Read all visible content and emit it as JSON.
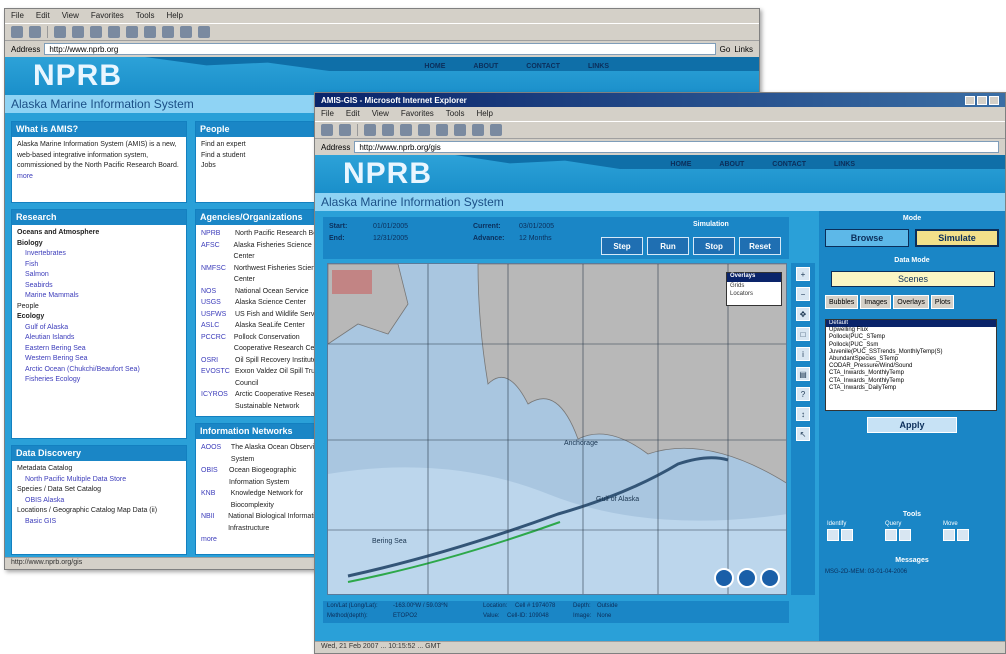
{
  "back_window": {
    "menu": [
      "File",
      "Edit",
      "View",
      "Favorites",
      "Tools",
      "Help"
    ],
    "address_label": "Address",
    "address": "http://www.nprb.org",
    "go_label": "Go",
    "links_label": "Links",
    "status": "http://www.nprb.org/gis"
  },
  "front_window": {
    "title": "AMIS-GIS - Microsoft Internet Explorer",
    "menu": [
      "File",
      "Edit",
      "View",
      "Favorites",
      "Tools",
      "Help"
    ],
    "address_label": "Address",
    "address": "http://www.nprb.org/gis",
    "status": "Wed, 21 Feb 2007 ... 10:15:52 ... GMT"
  },
  "site": {
    "logo": "NPRB",
    "subtitle": "Alaska Marine Information System",
    "nav": [
      "HOME",
      "ABOUT",
      "CONTACT",
      "LINKS"
    ]
  },
  "portal": {
    "what_is": {
      "title": "What is AMIS?",
      "body": "Alaska Marine Information System (AMIS) is a new, web-based integrative information system, commissioned by the North Pacific Research Board.",
      "more": "more"
    },
    "research": {
      "title": "Research",
      "items": [
        {
          "text": "Oceans and Atmosphere",
          "style": "bold"
        },
        {
          "text": "Biology",
          "style": "bold"
        },
        {
          "text": "Invertebrates",
          "style": "link"
        },
        {
          "text": "Fish",
          "style": "link"
        },
        {
          "text": "Salmon",
          "style": "link"
        },
        {
          "text": "Seabirds",
          "style": "link"
        },
        {
          "text": "Marine Mammals",
          "style": "link"
        },
        {
          "text": "People",
          "style": "plain"
        },
        {
          "text": "Ecology",
          "style": "bold"
        },
        {
          "text": "Gulf of Alaska",
          "style": "link"
        },
        {
          "text": "Aleutian Islands",
          "style": "link"
        },
        {
          "text": "Eastern Bering Sea",
          "style": "link"
        },
        {
          "text": "Western Bering Sea",
          "style": "link"
        },
        {
          "text": "Arctic Ocean (Chukchi/Beaufort Sea)",
          "style": "link"
        },
        {
          "text": "Fisheries Ecology",
          "style": "link"
        }
      ]
    },
    "data_discovery": {
      "title": "Data Discovery",
      "items": [
        {
          "text": "Metadata Catalog",
          "style": "plain"
        },
        {
          "text": "North Pacific Multiple Data Store",
          "style": "link"
        },
        {
          "text": "Species / Data Set Catalog",
          "style": "plain"
        },
        {
          "text": "OBIS Alaska",
          "style": "link"
        },
        {
          "text": "Locations / Geographic Catalog Map Data (ii)",
          "style": "plain"
        },
        {
          "text": "Basic GIS",
          "style": "link"
        }
      ]
    },
    "people": {
      "title": "People",
      "items": [
        "Find an expert",
        "Find a student",
        "Jobs"
      ]
    },
    "agencies": {
      "title": "Agencies/Organizations",
      "rows": [
        {
          "abbr": "NPRB",
          "name": "North Pacific Research Board"
        },
        {
          "abbr": "AFSC",
          "name": "Alaska Fisheries Science Center"
        },
        {
          "abbr": "NMFSC",
          "name": "Northwest Fisheries Science Center"
        },
        {
          "abbr": "NOS",
          "name": "National Ocean Service"
        },
        {
          "abbr": "USGS",
          "name": "Alaska Science Center"
        },
        {
          "abbr": "USFWS",
          "name": "US Fish and Wildlife Service"
        },
        {
          "abbr": "ASLC",
          "name": "Alaska SeaLife Center"
        },
        {
          "abbr": "PCCRC",
          "name": "Pollock Conservation Cooperative Research Center"
        },
        {
          "abbr": "OSRI",
          "name": "Oil Spill Recovery Institute"
        },
        {
          "abbr": "EVOSTC",
          "name": "Exxon Valdez Oil Spill Trustee Council"
        },
        {
          "abbr": "ICYROS",
          "name": "Arctic Cooperative Research Sustainable Network"
        }
      ]
    },
    "info_networks": {
      "title": "Information Networks",
      "rows": [
        {
          "abbr": "AOOS",
          "name": "The Alaska Ocean Observing System"
        },
        {
          "abbr": "OBIS",
          "name": "Ocean Biogeographic Information System"
        },
        {
          "abbr": "KNB",
          "name": "Knowledge Network for Biocomplexity"
        },
        {
          "abbr": "NBII",
          "name": "National Biological Information Infrastructure"
        },
        {
          "abbr": "more",
          "name": ""
        }
      ]
    }
  },
  "app": {
    "fields": {
      "start_label": "Start:",
      "start_value": "01/01/2005",
      "end_label": "End:",
      "end_value": "12/31/2005",
      "current_label": "Current:",
      "current_value": "03/01/2005",
      "advance_label": "Advance:",
      "advance_value": "12 Months"
    },
    "simulation_title": "Simulation",
    "sim_buttons": [
      "Step",
      "Run",
      "Stop",
      "Reset"
    ],
    "overlays": {
      "title": "Overlays",
      "items": [
        "Grids",
        "Locators"
      ]
    },
    "map_labels": {
      "gulf": "Gulf of Alaska",
      "bering": "Bering Sea",
      "anchorage": "Anchorage"
    },
    "readout": {
      "lonlat_label": "Lon/Lat (Long/Lat):",
      "lonlat_value": "-163.00ºW / 59.03ºN",
      "location_label": "Location:",
      "location_value": "Cell # 1974078",
      "depth_label": "Depth:",
      "depth_value": "Outside",
      "method_label": "Method(depth):",
      "method_value": "ETOPO2",
      "value_label": "Value:",
      "value_value": "Cell-ID: 109048",
      "image_label": "Image:",
      "image_value": "None"
    },
    "side": {
      "mode_title": "Mode",
      "browse": "Browse",
      "simulate": "Simulate",
      "data_mode_title": "Data Mode",
      "scenes": "Scenes",
      "tabs": [
        "Bubbles",
        "Images",
        "Overlays",
        "Plots"
      ],
      "list": [
        "Default",
        "Upwelling Flux",
        "Pollock(PUC_STemp",
        "Pollock(PUC_Ssm",
        "Juvenile(PUC_SSTrends_MonthlyTemp(S)",
        "AbundantSpecies_STemp",
        "CODAR_Pressure/Wind/Sound",
        "CTA_Inwards_MonthlyTemp",
        "CTA_Inwards_MonthlyTemp",
        "CTA_Inwards_DailyTemp"
      ],
      "apply": "Apply",
      "tools_title": "Tools",
      "tool_groups": [
        "Identify",
        "Query",
        "Move"
      ],
      "messages_title": "Messages",
      "messages_text": "MSG-2D-MEM: 03-01-04-2006"
    }
  }
}
